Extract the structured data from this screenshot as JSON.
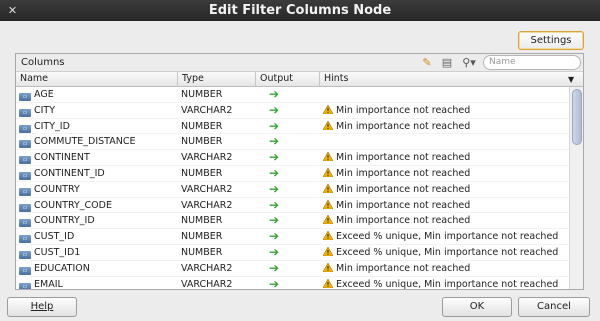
{
  "window": {
    "title": "Edit Filter Columns Node"
  },
  "toolbar": {
    "settings_label": "Settings"
  },
  "panel": {
    "title": "Columns",
    "search_placeholder": "Name"
  },
  "table": {
    "headers": [
      "Name",
      "Type",
      "Output",
      "Hints"
    ],
    "rows": [
      {
        "name": "AGE",
        "type": "NUMBER",
        "hint": ""
      },
      {
        "name": "CITY",
        "type": "VARCHAR2",
        "hint": "Min importance not reached"
      },
      {
        "name": "CITY_ID",
        "type": "NUMBER",
        "hint": "Min importance not reached"
      },
      {
        "name": "COMMUTE_DISTANCE",
        "type": "NUMBER",
        "hint": ""
      },
      {
        "name": "CONTINENT",
        "type": "VARCHAR2",
        "hint": "Min importance not reached"
      },
      {
        "name": "CONTINENT_ID",
        "type": "NUMBER",
        "hint": "Min importance not reached"
      },
      {
        "name": "COUNTRY",
        "type": "VARCHAR2",
        "hint": "Min importance not reached"
      },
      {
        "name": "COUNTRY_CODE",
        "type": "VARCHAR2",
        "hint": "Min importance not reached"
      },
      {
        "name": "COUNTRY_ID",
        "type": "NUMBER",
        "hint": "Min importance not reached"
      },
      {
        "name": "CUST_ID",
        "type": "NUMBER",
        "hint": "Exceed % unique, Min importance not reached"
      },
      {
        "name": "CUST_ID1",
        "type": "NUMBER",
        "hint": "Exceed % unique, Min importance not reached"
      },
      {
        "name": "EDUCATION",
        "type": "VARCHAR2",
        "hint": "Min importance not reached"
      },
      {
        "name": "EMAIL",
        "type": "VARCHAR2",
        "hint": "Exceed % unique, Min importance not reached"
      }
    ]
  },
  "footer": {
    "help_label": "Help",
    "ok_label": "OK",
    "cancel_label": "Cancel"
  },
  "icons": {
    "close": "close-icon",
    "pencil": "pencil-icon",
    "clipboard": "clipboard-icon",
    "search": "search-icon",
    "column": "column-icon",
    "output": "arrow-right-icon",
    "warning": "warning-icon",
    "menu": "chevron-down-icon"
  },
  "colors": {
    "accent_border": "#d9a23a",
    "output_arrow": "#35a535",
    "warning": "#f0b400",
    "titlebar": "#2d2d2d"
  }
}
